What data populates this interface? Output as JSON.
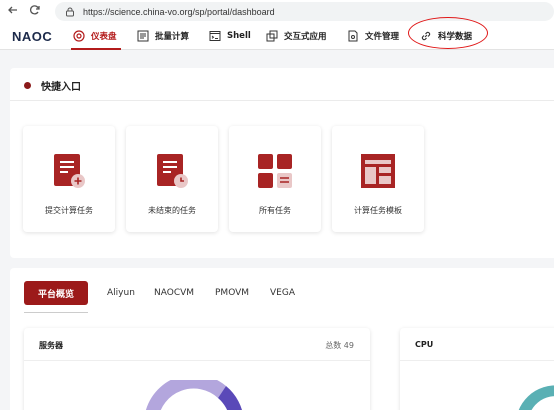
{
  "browser": {
    "url": "https://science.china-vo.org/sp/portal/dashboard",
    "back_icon": "arrow-left-icon",
    "reload_icon": "reload-icon"
  },
  "header": {
    "logo": "NAOC",
    "nav": [
      {
        "label": "仪表盘",
        "icon": "dashboard-icon",
        "active": true
      },
      {
        "label": "批量计算",
        "icon": "list-icon"
      },
      {
        "label": "Shell",
        "icon": "terminal-icon"
      },
      {
        "label": "交互式应用",
        "icon": "app-icon"
      },
      {
        "label": "文件管理",
        "icon": "file-icon"
      },
      {
        "label": "科学数据",
        "icon": "link-icon"
      }
    ],
    "accent": "#b31b1b"
  },
  "quick": {
    "title": "快捷入口",
    "tiles": [
      {
        "label": "提交计算任务",
        "icon": "doc-plus-icon"
      },
      {
        "label": "未结束的任务",
        "icon": "doc-clock-icon"
      },
      {
        "label": "所有任务",
        "icon": "grid-icon"
      },
      {
        "label": "计算任务模板",
        "icon": "template-icon"
      }
    ]
  },
  "platform": {
    "tabs": [
      "平台概览",
      "Aliyun",
      "NAOCVM",
      "PMOVM",
      "VEGA"
    ],
    "server": {
      "title": "服务器",
      "count": "总数 49"
    },
    "cpu": {
      "title": "CPU"
    }
  }
}
